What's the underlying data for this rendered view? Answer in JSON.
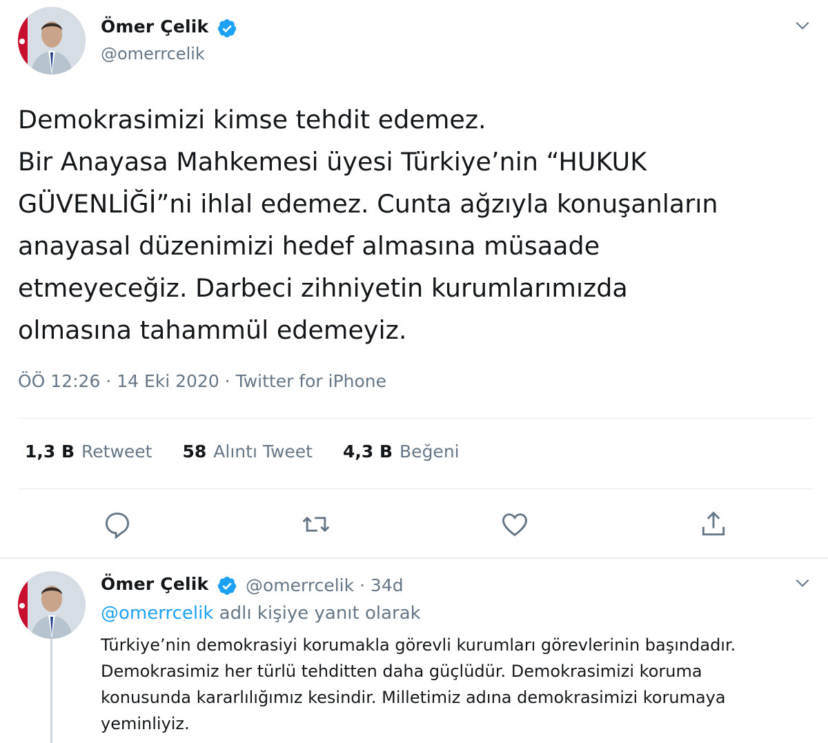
{
  "main_tweet": {
    "author": {
      "name": "Ömer Çelik",
      "handle": "@omerrcelik"
    },
    "text": "Demokrasimizi kimse tehdit edemez.\nBir Anayasa Mahkemesi üyesi Türkiye’nin “HUKUK\nGÜVENLİĞİ”ni ihlal edemez. Cunta ağzıyla konuşanların\nanayasal düzenimizi hedef almasına müsaade\netmeyeceğiz. Darbeci zihniyetin kurumlarımızda\nolmasına tahammül edemeyiz.",
    "meta": "ÖÖ 12:26 · 14 Eki 2020 · Twitter for iPhone",
    "stats": {
      "retweets_count": "1,3 B",
      "retweets_label": "Retweet",
      "quotes_count": "58",
      "quotes_label": "Alıntı Tweet",
      "likes_count": "4,3 B",
      "likes_label": "Beğeni"
    },
    "actions": [
      "reply-icon",
      "retweet-icon",
      "like-icon",
      "share-icon"
    ]
  },
  "reply_tweet": {
    "author": {
      "name": "Ömer Çelik",
      "handle_time": "@omerrcelik · 34d"
    },
    "reply_to_mention": "@omerrcelik",
    "reply_to_suffix": " adlı kişiye yanıt olarak",
    "text": "Türkiye’nin demokrasiyi korumakla görevli kurumları görevlerinin başındadır.\nDemokrasimiz her türlü tehditten daha güçlüdür. Demokrasimizi koruma\nkonusunda kararlılığımız kesindir. Milletimiz adına demokrasimizi korumaya\nyeminliyiz."
  },
  "colors": {
    "text": "#14171a",
    "secondary": "#657786",
    "accent": "#1da1f2",
    "divider": "#e6ecf0"
  }
}
